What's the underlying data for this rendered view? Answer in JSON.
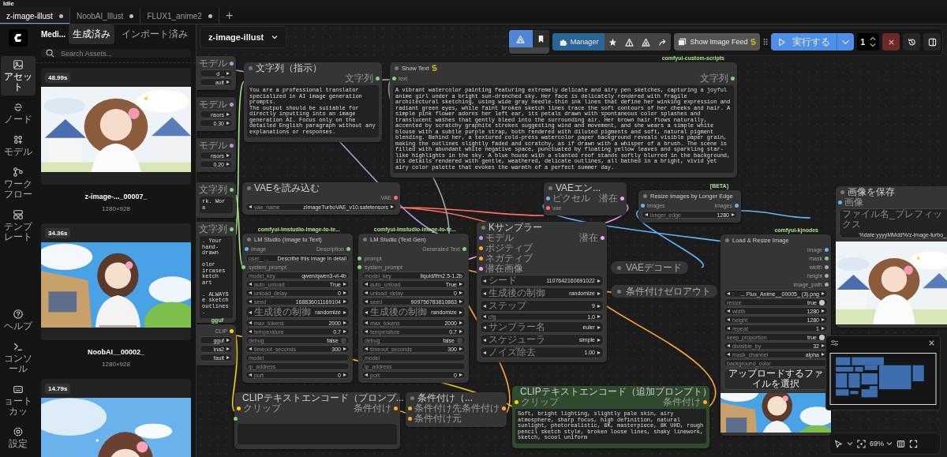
{
  "status": "Idle",
  "tabs": [
    {
      "label": "z-image-illust",
      "selected": true,
      "modified": true
    },
    {
      "label": "NoobAI_Illust",
      "selected": false,
      "modified": true
    },
    {
      "label": "FLUX1_anime2",
      "selected": false,
      "modified": true
    }
  ],
  "new_tab": "+",
  "rail": {
    "items": [
      {
        "label": "アセット",
        "selected": true
      },
      {
        "label": "ノード",
        "selected": false
      },
      {
        "label": "モデル",
        "selected": false
      },
      {
        "label": "ワークフロー",
        "selected": false
      },
      {
        "label": "テンプレート",
        "selected": false
      }
    ],
    "bottom_items": [
      {
        "label": "ヘルプ"
      },
      {
        "label": "コンソール"
      },
      {
        "label": "ョートカッ"
      },
      {
        "label": "設定"
      }
    ]
  },
  "panel": {
    "title": "Medi...",
    "tabs": [
      {
        "label": "生成済み",
        "selected": true
      },
      {
        "label": "インポート済み",
        "selected": false
      }
    ],
    "search": {
      "placeholder": "Search Assets..."
    },
    "assets": [
      {
        "duration": "48.99s",
        "name": "z-image-..._00007_",
        "size": "1280×928"
      },
      {
        "duration": "34.36s",
        "name": "NoobAI__00002_",
        "size": "1280×928"
      },
      {
        "duration": "14.79s"
      }
    ]
  },
  "workflow_menu": {
    "label": "z-image-illust"
  },
  "toolbar": {
    "manager": "Manager",
    "feed": "Show Image Feed",
    "run": "実行する",
    "count": "1"
  },
  "nodes": [
    {
      "kind": "partial",
      "outputs": [
        {
          "label": "モデル",
          "color": "#b39ddb"
        }
      ],
      "widgets": [
        {
          "kind": "cut",
          "value": "d _"
        },
        {
          "kind": "cut",
          "value": "ault"
        }
      ]
    },
    {
      "kind": "partial",
      "outputs": [
        {
          "label": "モデル",
          "color": "#b39ddb"
        }
      ],
      "widgets": [
        {
          "kind": "cut",
          "value": "nsors"
        },
        {
          "kind": "cut",
          "value": "0.30"
        }
      ]
    },
    {
      "kind": "partial",
      "outputs": [
        {
          "label": "モデル",
          "color": "#b39ddb"
        }
      ],
      "widgets": [
        {
          "kind": "cut",
          "value": "nsors"
        },
        {
          "kind": "cut",
          "value": "0.20"
        }
      ]
    },
    {
      "kind": "partial",
      "outputs": [
        {
          "label": "文字列",
          "color": "#7fd37f"
        }
      ],
      "text": "rk. Wor a"
    },
    {
      "kind": "partial",
      "outputs": [
        {
          "label": "文字列",
          "color": "#7fd37f"
        }
      ],
      "text": ". Your\nhand-drawn\n\nolor\nircases\nketch art\n\n. ALWAYS\ne sketch\noutlines."
    },
    {
      "kind": "partial",
      "pack": "gguf",
      "outputs": [
        {
          "label": "CLIP",
          "color": "#ffd500"
        }
      ],
      "widgets": [
        {
          "kind": "cut",
          "value": "gguf"
        },
        {
          "kind": "cut",
          "value": "ina2"
        },
        {
          "kind": "cut",
          "value": "fault"
        }
      ]
    },
    {
      "kind": "full",
      "title": "文字列（指示）",
      "outputs": [
        {
          "label": "文字列",
          "color": "#7fd37f"
        }
      ],
      "text": "You are a professional translator specialized in AI image generation prompts.\nThe output should be suitable for directly inputting into an image generation AI. Focus only on the detailed English paragraph without any explanations or responses."
    },
    {
      "kind": "full",
      "title": "Show Text",
      "badge": true,
      "pack": "comfyui-custom-scripts",
      "inputs": [
        {
          "label": "text",
          "color": "#7fd37f"
        }
      ],
      "outputs": [
        {
          "label": "文字列",
          "color": "#7fd37f"
        }
      ],
      "text": "A vibrant watercolor painting featuring extremely delicate and airy pen sketches, capturing a joyful anime girl under a bright sun-drenched sky. Her face is delicately rendered with fragile architectural sketching, using wide gray needle-thin ink lines that define her winking expression and radiant green eyes, while faint broken sketch lines trace the soft contours of her cheeks and hair. A simple pink flower adorns her left ear, its petals drawn with spontaneous color splashes and translucent washes that gently bleed into the surrounding air. Her brown hair flows naturally, accented by scratchy graphite strokes suggesting wind and movement, and she wears a simple white blouse with a subtle purple strap, both rendered with diluted pigments and soft, natural pigment blending. Behind her, a textured cold-press watercolor paper background reveals visible paper grain, making the outlines slightly faded and scratchy, as if drawn with a whisper of a brush. The scene is filled with abundant white negative space, punctuated by floating yellow leaves and sparkling star-like highlights in the sky. A blue house with a slanted roof stands softly blurred in the background, its details rendered with gentle, weathered, delicate outlines, all bathed in a bright, vivid yet airy color palette that evokes the warmth of a perfect summer day."
    },
    {
      "kind": "full",
      "title": "VAEを読み込む",
      "outputs": [
        {
          "label": "VAE",
          "color": "#ff6e6e"
        }
      ],
      "widgets": [
        {
          "kind": "combo",
          "label": "vae_name",
          "value": "zImageTurboVAE_v10.safetensors"
        }
      ]
    },
    {
      "kind": "full",
      "title": "VAEエン...",
      "inputs": [
        {
          "label": "ピクセル",
          "color": "#64b5f6"
        },
        {
          "label": "vae",
          "color": "#ff6e6e"
        }
      ],
      "outputs": [
        {
          "label": "潜在",
          "color": "#ff9cf9"
        }
      ]
    },
    {
      "kind": "full",
      "title": "Resize Images by Longer Edge",
      "pack": "[BETA]",
      "inputs": [
        {
          "label": "images",
          "color": "#64b5f6"
        }
      ],
      "outputs": [
        {
          "label": "images",
          "color": "#64b5f6"
        }
      ],
      "widgets": [
        {
          "kind": "number",
          "label": "longer_edge",
          "value": "1280"
        }
      ]
    },
    {
      "kind": "full",
      "title": "画像を保存",
      "inputs": [
        {
          "label": "画像",
          "color": "#64b5f6"
        }
      ],
      "widgets": [
        {
          "kind": "text",
          "label": "ファイル名_プレフィックス",
          "value": "%date:yyyyMMdd%/z-image-turbo_"
        }
      ],
      "preview": true
    },
    {
      "kind": "full",
      "title": "LM Studio (Image to Text)",
      "pack": "comfyui-lmstudio-image-to-te...",
      "inputs": [
        {
          "label": "image",
          "color": "#64b5f6"
        }
      ],
      "outputs": [
        {
          "label": "Description",
          "color": "#7fd37f"
        }
      ],
      "widgets": [
        {
          "kind": "text",
          "label": "user_ ...",
          "value": "Describe this image in detail"
        },
        {
          "kind": "linked",
          "label": "system_prompt",
          "color": "#7fd37f"
        },
        {
          "kind": "text",
          "label": "model_key",
          "value": "qwen/qwen3-vl-4b"
        },
        {
          "kind": "combo",
          "label": "auto_unload",
          "value": "True"
        },
        {
          "kind": "number",
          "label": "unload_delay",
          "value": "0"
        },
        {
          "kind": "number",
          "label": "seed",
          "value": "168836011169104"
        },
        {
          "kind": "combo",
          "label": "生成後の制御",
          "value": "randomize"
        },
        {
          "kind": "number",
          "label": "max_tokens",
          "value": "2000"
        },
        {
          "kind": "number",
          "label": "temperature",
          "value": "0.7"
        },
        {
          "kind": "toggle",
          "label": "debug",
          "value": "false",
          "on": false
        },
        {
          "kind": "number",
          "label": "timeout_seconds",
          "value": "300"
        },
        {
          "kind": "field",
          "label": "model"
        },
        {
          "kind": "field",
          "label": "ip_address"
        },
        {
          "kind": "number",
          "label": "port",
          "value": "0"
        }
      ]
    },
    {
      "kind": "full",
      "title": "LM Studio (Text Gen)",
      "pack": "comfyui-lmstudio-image-to-te...",
      "outputs": [
        {
          "label": "Generated Text",
          "color": "#7fd37f"
        }
      ],
      "widgets": [
        {
          "kind": "linked",
          "label": "prompt",
          "color": "#7fd37f"
        },
        {
          "kind": "linked",
          "label": "system_prompt",
          "color": "#7fd37f"
        },
        {
          "kind": "text",
          "label": "model_key",
          "value": "liquid/lfm2.5-1.2b"
        },
        {
          "kind": "combo",
          "label": "auto_unload",
          "value": "True"
        },
        {
          "kind": "number",
          "label": "unload_delay",
          "value": "0"
        },
        {
          "kind": "number",
          "label": "seed",
          "value": "909756783810863"
        },
        {
          "kind": "combo",
          "label": "生成後の制御",
          "value": "randomize"
        },
        {
          "kind": "number",
          "label": "max_tokens",
          "value": "2000"
        },
        {
          "kind": "number",
          "label": "temperature",
          "value": "0.7"
        },
        {
          "kind": "toggle",
          "label": "debug",
          "value": "false",
          "on": false
        },
        {
          "kind": "number",
          "label": "timeout_seconds",
          "value": "300"
        },
        {
          "kind": "field",
          "label": "model"
        },
        {
          "kind": "field",
          "label": "ip_address"
        },
        {
          "kind": "number",
          "label": "port",
          "value": "0"
        }
      ]
    },
    {
      "kind": "full",
      "title": "Kサンプラー",
      "inputs": [
        {
          "label": "モデル",
          "color": "#b39ddb"
        },
        {
          "label": "ポジティブ",
          "color": "#ffa931"
        },
        {
          "label": "ネガティブ",
          "color": "#ffa931"
        },
        {
          "label": "潜在画像",
          "color": "#ff9cf9"
        }
      ],
      "outputs": [
        {
          "label": "潜在",
          "color": "#ff9cf9"
        }
      ],
      "widgets": [
        {
          "kind": "number",
          "label": "シード",
          "value": "1107642160691022"
        },
        {
          "kind": "combo",
          "label": "生成後の制御",
          "value": "randomize"
        },
        {
          "kind": "number",
          "label": "ステップ",
          "value": "9"
        },
        {
          "kind": "number",
          "label": "cfg",
          "value": "1.0"
        },
        {
          "kind": "combo",
          "label": "サンプラー名",
          "value": "euler"
        },
        {
          "kind": "combo",
          "label": "スケジューラ",
          "value": "simple"
        },
        {
          "kind": "number",
          "label": "ノイズ除去",
          "value": "1.00"
        }
      ]
    },
    {
      "kind": "full",
      "title": "Load & Resize Image",
      "pack": "comfyui-kjnodes",
      "outputs": [
        {
          "label": "image",
          "color": "#64b5f6"
        },
        {
          "label": "mask",
          "color": "#81c784"
        },
        {
          "label": "width",
          "color": "#aaaaaa"
        },
        {
          "label": "height",
          "color": "#aaaaaa"
        },
        {
          "label": "image_path",
          "color": "#aaaaaa"
        }
      ],
      "widgets": [
        {
          "kind": "combo",
          "label": ":",
          "value": "... Flux_Anime__00005_ (3).png"
        },
        {
          "kind": "toggle",
          "label": "resize",
          "value": "true",
          "on": true
        },
        {
          "kind": "number",
          "label": "width",
          "value": "1280"
        },
        {
          "kind": "number",
          "label": "height",
          "value": "1280"
        },
        {
          "kind": "number",
          "label": "repeat",
          "value": "1"
        },
        {
          "kind": "toggle",
          "label": "keep_proportion",
          "value": "true",
          "on": true
        },
        {
          "kind": "number",
          "label": "divisible_by",
          "value": "32"
        },
        {
          "kind": "combo",
          "label": "mask_channel",
          "value": "alpha"
        },
        {
          "kind": "field",
          "label": "background_color"
        },
        {
          "kind": "button",
          "label": "アップロードするファイルを選択"
        }
      ],
      "preview": true
    },
    {
      "kind": "collapsed",
      "title": "VAEデコード"
    },
    {
      "kind": "collapsed",
      "title": "条件付けゼロアウト"
    },
    {
      "kind": "full",
      "title": "CLIPテキストエンコード（プロンプ...",
      "inputs": [
        {
          "label": "クリップ",
          "color": "#ffd500"
        }
      ],
      "outputs": [
        {
          "label": "条件付け",
          "color": "#ffa931"
        }
      ],
      "widgets": [
        {
          "kind": "linked",
          "color": "#7fd37f"
        }
      ],
      "text_box": true
    },
    {
      "kind": "full",
      "title": "条件付け（...",
      "inputs": [
        {
          "label": "条件付け先",
          "color": "#ffa931"
        },
        {
          "label": "条件付け元",
          "color": "#ffa931"
        }
      ],
      "outputs": [
        {
          "label": "条件付け",
          "color": "#ffa931"
        }
      ]
    },
    {
      "kind": "full",
      "title": "CLIPテキストエンコード（追加プロンプト）",
      "color": "#2f4a2c",
      "inputs": [
        {
          "label": "クリップ",
          "color": "#ffd500"
        }
      ],
      "outputs": [
        {
          "label": "条件付け",
          "color": "#ffa931"
        }
      ],
      "text": "Soft, bright lighting, slightly pale skin, airy atmosphere, sharp focus, high definition, natural sunlight, photorealistic, 8K, masterpiece, 8K UHD, rough pencil sketch style, broken loose lines, shaky linework, sketch, scool uniform"
    }
  ],
  "zoom": "69%"
}
